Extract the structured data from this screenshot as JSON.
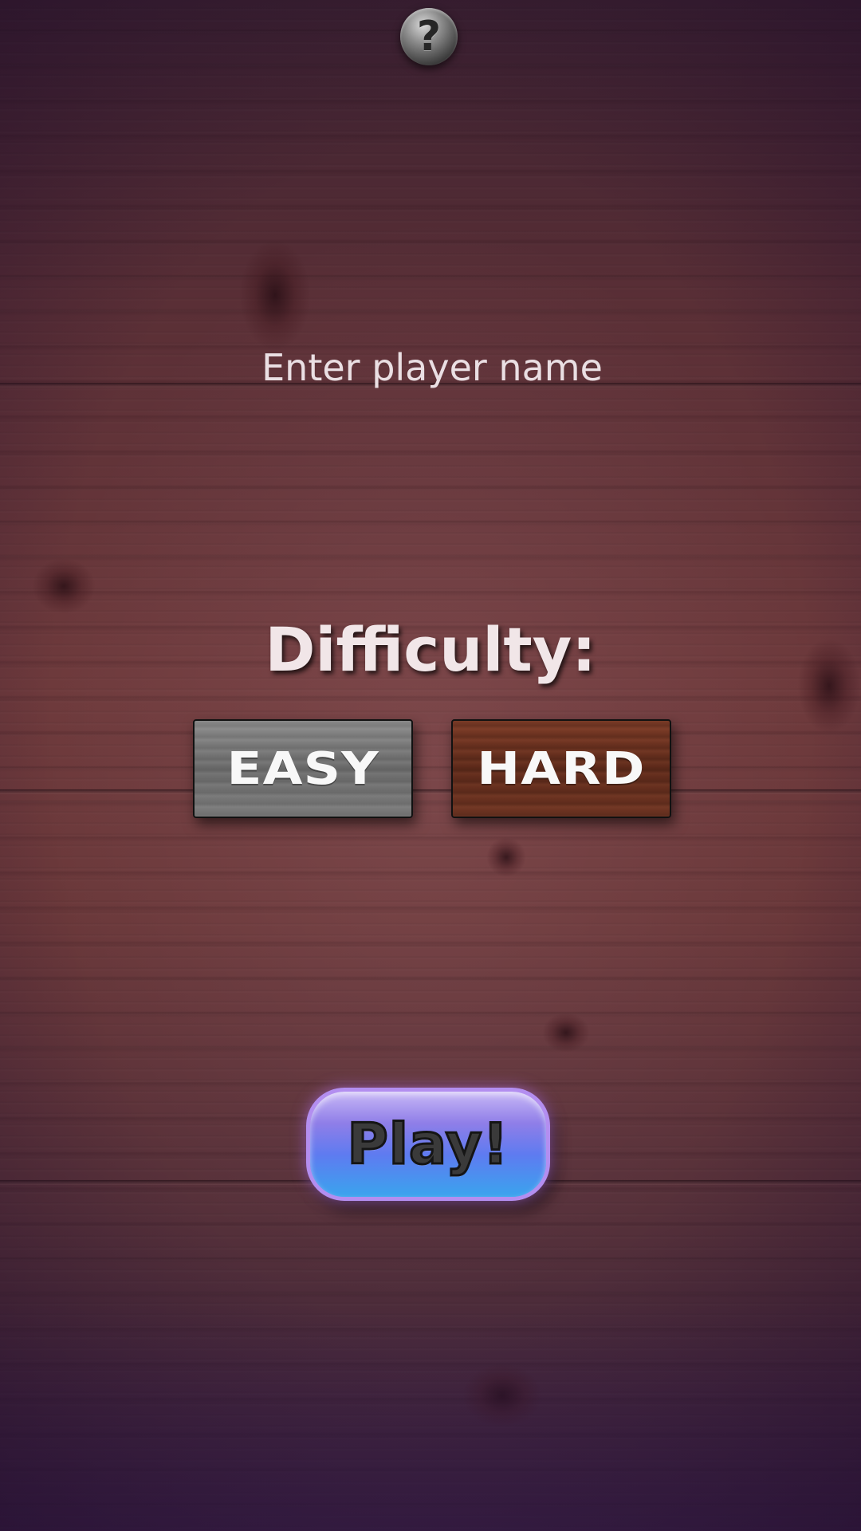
{
  "help_button": {
    "icon": "question-mark-icon",
    "glyph": "?"
  },
  "player_name": {
    "value": "",
    "placeholder": "Enter player name"
  },
  "difficulty": {
    "title": "Difficulty:",
    "options": [
      {
        "label": "EASY",
        "color": "#7a7a7a"
      },
      {
        "label": "HARD",
        "color": "#6e3422"
      }
    ]
  },
  "play_button": {
    "label": "Play!"
  },
  "colors": {
    "background_wood": "#6e3a3c",
    "play_button_top": "#c8b8f6",
    "play_button_bottom": "#3aa4ee"
  }
}
